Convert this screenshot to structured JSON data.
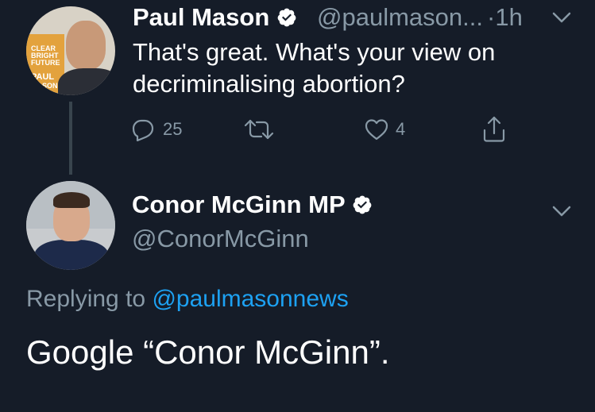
{
  "parent_tweet": {
    "display_name": "Paul Mason",
    "handle": "@paulmason...",
    "separator": "·",
    "time": "1h",
    "text": "That's great. What's your view on decriminalising abortion?",
    "avatar_book_text": [
      "CLEAR",
      "BRIGHT",
      "FUTURE",
      "PAUL",
      "MASON"
    ],
    "actions": {
      "reply_count": "25",
      "retweet_count": "",
      "like_count": "4"
    }
  },
  "main_tweet": {
    "display_name": "Conor McGinn MP",
    "handle": "@ConorMcGinn",
    "replying_prefix": "Replying to",
    "replying_to": "@paulmasonnews",
    "text": "Google “Conor McGinn”."
  },
  "colors": {
    "background": "#151c28",
    "secondary_text": "#8899a6",
    "link": "#1da1f2",
    "thread_line": "#38444d"
  },
  "icons": [
    "verified-badge-icon",
    "chevron-down-icon",
    "reply-icon",
    "retweet-icon",
    "like-icon",
    "share-icon"
  ]
}
